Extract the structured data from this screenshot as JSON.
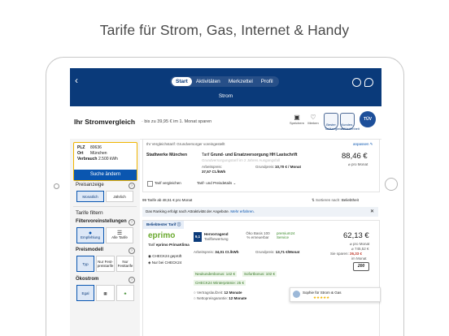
{
  "headline": "Tarife für Strom, Gas, Internet & Handy",
  "topbar": {
    "back_label": "‹",
    "tabs": [
      {
        "label": "Start",
        "active": true
      },
      {
        "label": "Aktivitäten",
        "active": false
      },
      {
        "label": "Merkzettel",
        "active": false
      },
      {
        "label": "Profil",
        "active": false
      }
    ],
    "subtitle": "Strom",
    "icons": [
      "search-icon",
      "chat-icon"
    ]
  },
  "header": {
    "title": "Ihr Stromvergleich",
    "savings": "bis zu 39,95 € im 1. Monat sparen",
    "icon_labels": {
      "save": "Speichern",
      "remember": "Merken"
    },
    "seals": [
      "Bester Tarifvergleich",
      "Kunden-zufriedenheit",
      "Bester Vergleich"
    ],
    "tuv": "TÜV"
  },
  "calc": {
    "plz_label": "PLZ",
    "plz": "80636",
    "ort_label": "Ort",
    "ort": "München",
    "verbrauch_label": "Verbrauch",
    "verbrauch": "2.500 kWh",
    "button": "Suche ändern"
  },
  "filters": {
    "preisanzeige": "Preisanzeige",
    "monatlich": "Monatlich",
    "jaehrlich": "Jährlich",
    "tarife_filtern": "Tarife filtern",
    "filtervoreinstellungen": "Filtervoreinstellungen",
    "empfehlung": "Empfehlung",
    "alle_tarife": "Alle Tarife",
    "preismodell": "Preismodell",
    "typ": "Typ",
    "nur_festpreis": "Nur Fest-preistarife",
    "nur_festarife": "Nur Festtarife",
    "oekostrom": "Ökostrom",
    "egal": "Egal"
  },
  "baseline": {
    "label": "Ihr Vergleichstarif: Grundversorger voreingestellt",
    "edit": "anpassen",
    "provider": "Stadtwerke München",
    "tariff_prefix": "Tarif",
    "tariff": "Grund- und Ersatzversorgung HH Lastschrift",
    "note": "Grundversorgungstarif im 2 Jahres Ausgangsfall",
    "arbeitspreis_label": "Arbeitspreis:",
    "arbeitspreis": "37,57 Ct./kWh",
    "grundpreis_label": "Grundpreis:",
    "grundpreis": "10,70 € / Monat",
    "price": "88,46 €",
    "price_label": "⌀ pro Monat",
    "compare": "Tarif vergleichen",
    "details": "Tarif- und Preisdetails ⌄"
  },
  "results": {
    "count": "99 Tarife ab 48,51 € pro Monat",
    "sort_label": "Sortieren nach:",
    "sort_value": "Beliebtheit",
    "info": "Das Ranking erfolgt nach Attraktivität der Angebote.",
    "info_link": "Mehr erfahren."
  },
  "offer": {
    "badge": "Beliebtester Tarif",
    "provider_logo": "eprimo",
    "tariff_prefix": "Tarif",
    "tariff": "eprimo PrimaKlima",
    "check24": "CHECK24 geprüft",
    "check24_bei": "Nur bei CHECK24",
    "rating_value": "9,1",
    "rating_label": "Hervorragend",
    "rating_sub": "Tarifbewertung",
    "oeko": "Öko Basis 100 % erneuerbar",
    "badge_green": "premium24 Service",
    "arbeitspreis_label": "Arbeitspreis:",
    "arbeitspreis": "34,01 Ct./kWh",
    "grundpreis_label": "Grundpreis:",
    "grundpreis": "13,71 €/Monat",
    "bonus1": "Neukundenbonus: 142 €",
    "bonus2": "Sofortbonus: 102 €",
    "bonus3": "CHECK24 Winterprämie: 25 €",
    "vertrag_label": "Vertragslaufzeit:",
    "vertrag": "12 Monate",
    "preisgarantie_label": "Nettopreisgarantie:",
    "preisgarantie": "12 Monate",
    "price": "62,13 €",
    "price_label": "⌀ pro Monat",
    "yearly": "⌀ 745,52 €",
    "savings_label": "Sie sparen:",
    "savings": "26,33 €",
    "savings_sub": "im Monat",
    "ecode": "200"
  },
  "popup": {
    "text": "Sophie für Strom & Gas",
    "stars": "★★★★★"
  }
}
